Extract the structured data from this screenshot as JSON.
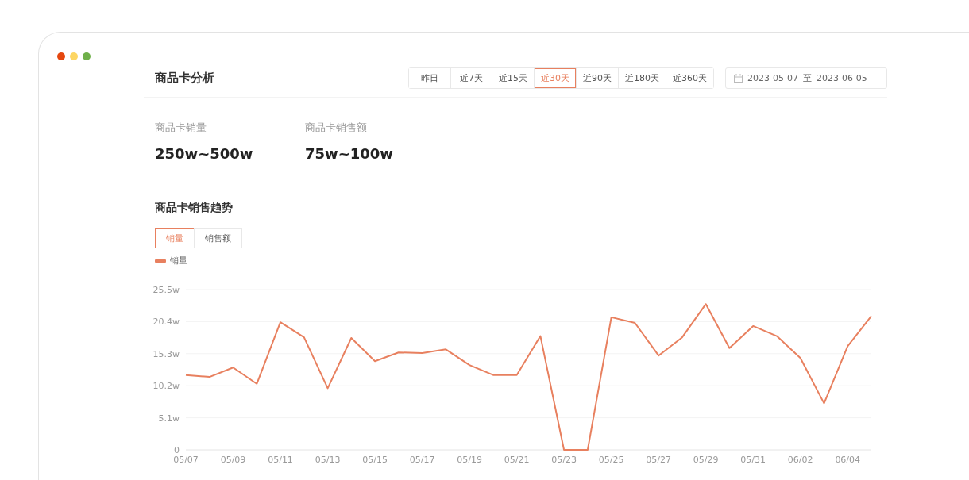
{
  "window": {
    "controls": [
      {
        "color": "#e5470f"
      },
      {
        "color": "#fdd663"
      },
      {
        "color": "#6fb04a"
      }
    ]
  },
  "header": {
    "title": "商品卡分析",
    "ranges": [
      {
        "label": "昨日",
        "selected": false
      },
      {
        "label": "近7天",
        "selected": false
      },
      {
        "label": "近15天",
        "selected": false
      },
      {
        "label": "近30天",
        "selected": true
      },
      {
        "label": "近90天",
        "selected": false
      },
      {
        "label": "近180天",
        "selected": false
      },
      {
        "label": "近360天",
        "selected": false
      }
    ],
    "date_range": {
      "start": "2023-05-07",
      "separator": "至",
      "end": "2023-06-05"
    }
  },
  "stats": [
    {
      "label": "商品卡销量",
      "value": "250w~500w"
    },
    {
      "label": "商品卡销售额",
      "value": "75w~100w"
    }
  ],
  "trend": {
    "title": "商品卡销售趋势",
    "tabs": [
      {
        "label": "销量",
        "selected": true
      },
      {
        "label": "销售额",
        "selected": false
      }
    ],
    "chart_data": {
      "type": "line",
      "categories": [
        "05/07",
        null,
        "05/09",
        null,
        "05/11",
        null,
        "05/13",
        null,
        "05/15",
        null,
        "05/17",
        null,
        "05/19",
        null,
        "05/21",
        null,
        "05/23",
        null,
        "05/25",
        null,
        "05/27",
        null,
        "05/29",
        null,
        "05/31",
        null,
        "06/02",
        null,
        "06/04",
        null
      ],
      "ylim": [
        0,
        25.5
      ],
      "grid": true,
      "yticks": [
        {
          "value": 0,
          "label": "0"
        },
        {
          "value": 5.1,
          "label": "5.1w"
        },
        {
          "value": 10.2,
          "label": "10.2w"
        },
        {
          "value": 15.3,
          "label": "15.3w"
        },
        {
          "value": 20.4,
          "label": "20.4w"
        },
        {
          "value": 25.5,
          "label": "25.5w"
        }
      ],
      "series": [
        {
          "name": "销量",
          "color": "#e8805f",
          "values": [
            11.9,
            11.6,
            13.1,
            10.5,
            20.3,
            17.9,
            9.8,
            17.8,
            14.1,
            15.5,
            15.4,
            16.0,
            13.5,
            11.9,
            11.9,
            18.1,
            0,
            0,
            21.1,
            20.2,
            15.0,
            17.9,
            23.2,
            16.2,
            19.7,
            18.1,
            14.6,
            7.4,
            16.5,
            21.3
          ]
        }
      ]
    }
  }
}
